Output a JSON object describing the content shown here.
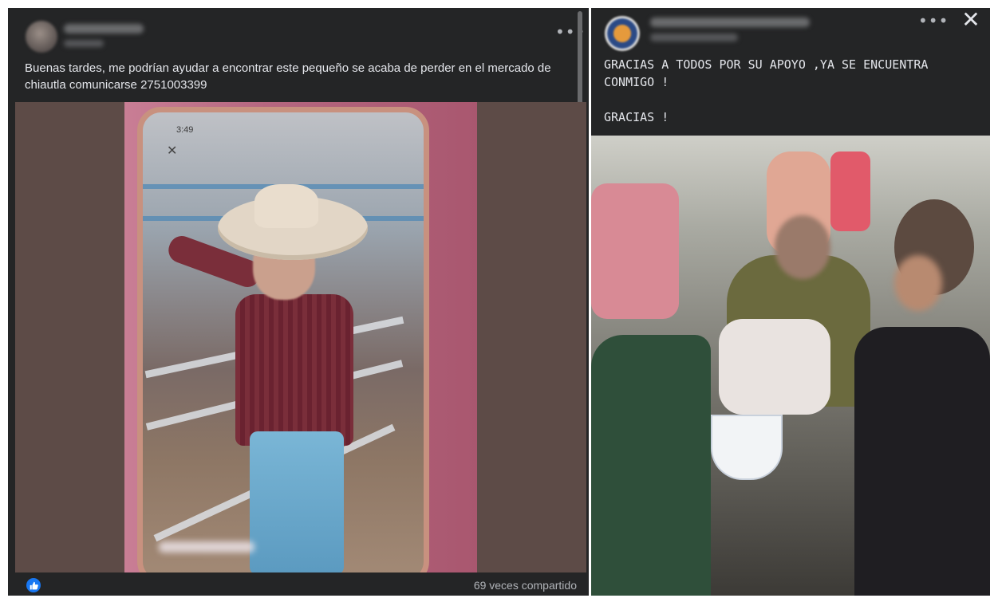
{
  "left_post": {
    "text": "Buenas tardes, me podrían ayudar a encontrar este pequeño se acaba de perder en el mercado de chiautla comunicarse 2751003399",
    "phone_status_time": "3:49",
    "options_icon": "more-dots-icon",
    "shares": "69 veces compartido",
    "like_icon": "like-thumb-icon"
  },
  "right_post": {
    "text": "GRACIAS A TODOS POR SU APOYO ,YA SE ENCUENTRA CONMIGO !\n\nGRACIAS !",
    "options_icon": "more-dots-icon",
    "close_label": "✕"
  },
  "colors": {
    "panel_bg": "#242526",
    "text": "#e4e6eb",
    "muted": "#b0b3b8",
    "like_blue": "#1877f2"
  }
}
